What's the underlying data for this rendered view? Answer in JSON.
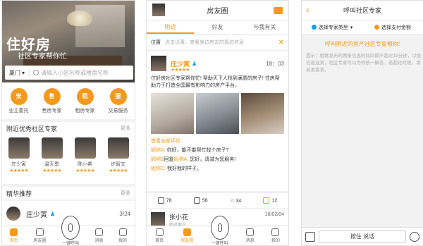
{
  "screen1": {
    "hero_title": "住好房",
    "hero_subtitle": "社区专家帮你忙",
    "city": "厦门",
    "search_placeholder": "请输入小区名称或楼盘名称",
    "services": [
      {
        "icon": "安",
        "label": "业主委托"
      },
      {
        "icon": "售",
        "label": "售房专家"
      },
      {
        "icon": "租",
        "label": "租房专家"
      },
      {
        "icon": "服",
        "label": "交易服务"
      }
    ],
    "nearby_title": "附近优秀社区专家",
    "more": "更多",
    "experts": [
      {
        "name": "庄少寅",
        "stars": "★★★★★"
      },
      {
        "name": "温天恩",
        "stars": "★★★★★"
      },
      {
        "name": "陈小希",
        "stars": "★★★★★"
      },
      {
        "name": "许智文",
        "stars": "★★★★★"
      }
    ],
    "featured_title": "精华推荐",
    "featured_name": "庄少寅",
    "featured_page": "3/24",
    "tabbar": [
      "首页",
      "房友圈",
      "一键呼叫",
      "消息",
      "我的"
    ]
  },
  "screen2": {
    "title": "房友圈",
    "tabs": [
      "附近",
      "好友",
      "与我有关"
    ],
    "location_label": "位置",
    "location_hint": "点击设置，查看身边房友的周边信息",
    "post": {
      "name": "庄少寅",
      "time": "18：03",
      "text": "住好房社区专家帮你忙! 帮助天下人找到满意的房子! 住房帮助力于打造全国最有影响力的房产平台。",
      "view_all_comments": "查看全部评论",
      "comments": [
        {
          "user": "昵称A:",
          "text": " 你好，能不能帮忙找个房子?"
        },
        {
          "user": "昵称B",
          "mid": "回复",
          "user2": "昵称A:",
          "text": " 您好，请减为您服务!"
        },
        {
          "user": "昵称C:",
          "text": " 我好我的样子。"
        }
      ],
      "likes": "78",
      "shares": "56",
      "favorites": "34",
      "comments_count": "12"
    },
    "post2": {
      "name": "张小花",
      "sub": "附近客户",
      "time": "16/02/04"
    },
    "tabbar": [
      "首页",
      "房友圈",
      "一键呼叫",
      "消息",
      "我的"
    ]
  },
  "screen3": {
    "title": "呼叫社区专家",
    "filter1": "选择专家类型",
    "filter2": "选择支付金额",
    "cta": "呼叫附近的房产社区专家帮你!",
    "tip": "提示：相继发布的两条信息时间间隔不超过15分钟，以免信息混淆，社区专家可以为你统一解答，若超过时限，请另发需求。",
    "hold_to_talk": "按住 说话"
  },
  "colors": {
    "accent": "#f39a1e",
    "badge": "#1a9be6"
  }
}
